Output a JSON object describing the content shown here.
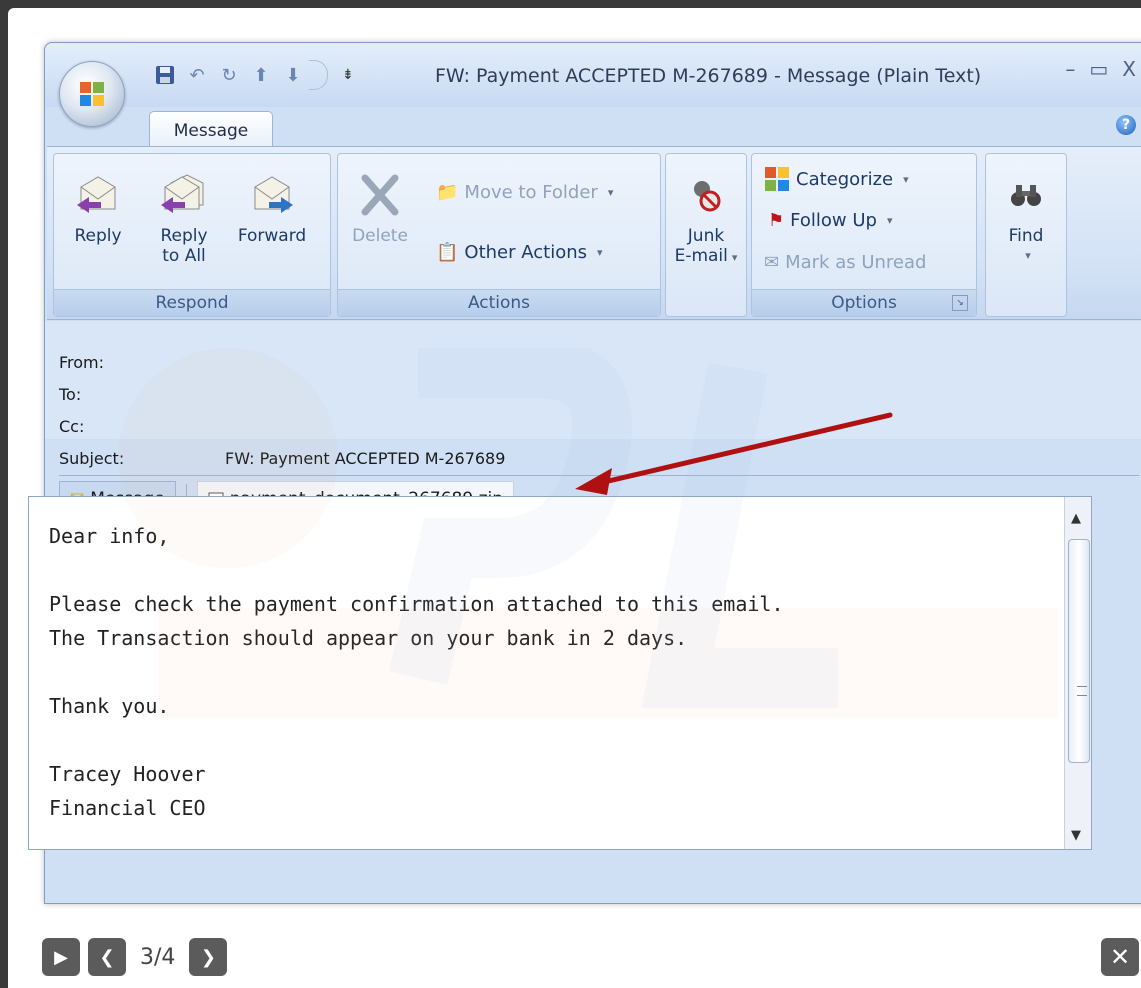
{
  "window": {
    "title": "FW: Payment ACCEPTED M-267689 - Message (Plain Text)",
    "controls": [
      "–",
      "▭",
      "X"
    ]
  },
  "ribbon": {
    "tab_label": "Message",
    "help_label": "?",
    "groups": {
      "respond": {
        "label": "Respond",
        "reply": "Reply",
        "reply_all_line1": "Reply",
        "reply_all_line2": "to All",
        "forward": "Forward"
      },
      "actions": {
        "label": "Actions",
        "delete": "Delete",
        "move_to_folder": "Move to Folder",
        "other_actions": "Other Actions"
      },
      "junk": {
        "line1": "Junk",
        "line2": "E-mail"
      },
      "options": {
        "label": "Options",
        "categorize": "Categorize",
        "follow_up": "Follow Up",
        "mark_as_unread": "Mark as Unread"
      },
      "find": {
        "label": "Find"
      }
    }
  },
  "header": {
    "from_label": "From:",
    "to_label": "To:",
    "cc_label": "Cc:",
    "subject_label": "Subject:",
    "subject_value": "FW: Payment ACCEPTED M-267689"
  },
  "attachments": {
    "message_tab": "Message",
    "file_name": "payment_document_267689.zip"
  },
  "body": {
    "text": "Dear info,\n\nPlease check the payment confirmation attached to this email.\nThe Transaction should appear on your bank in 2 days.\n\nThank you.\n\nTracey Hoover\nFinancial CEO"
  },
  "lightbox": {
    "counter": "3/4",
    "close": "✕"
  },
  "colors": {
    "annotation_arrow": "#b01010",
    "ribbon_bg": "#d3e2f5"
  }
}
